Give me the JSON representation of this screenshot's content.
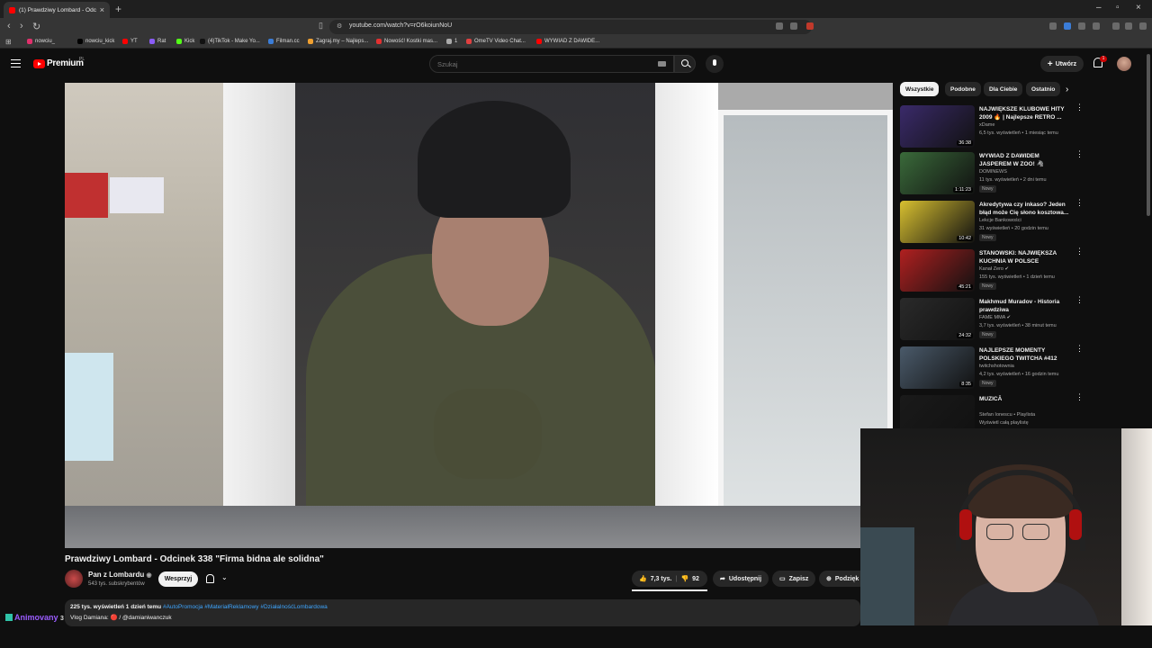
{
  "browser": {
    "tab_title": "(1) Prawdziwy Lombard - Odc...",
    "url": "youtube.com/watch?v=rO6koiunNoU",
    "bookmarks": [
      {
        "label": "nowciu_",
        "color": "#e1306c"
      },
      {
        "label": "nowciu_kick",
        "color": "#000000"
      },
      {
        "label": "YT",
        "color": "#ff0000"
      },
      {
        "label": "Rat",
        "color": "#8a5cf6"
      },
      {
        "label": "Kick",
        "color": "#53fc18"
      },
      {
        "label": "(4)TikTok - Make Yo...",
        "color": "#111111"
      },
      {
        "label": "Filman.cc",
        "color": "#3b7dd8"
      },
      {
        "label": "Zagraj.my – Najleps...",
        "color": "#f0a030"
      },
      {
        "label": "Nowość! Kostki mas...",
        "color": "#e23030"
      },
      {
        "label": "1",
        "color": "#aaaaaa"
      },
      {
        "label": "OmeTV Video Chat...",
        "color": "#e04040"
      },
      {
        "label": "WYWIAD Z DAWIDE...",
        "color": "#ff0000"
      }
    ]
  },
  "header": {
    "logo_text": "Premium",
    "country": "PL",
    "search_placeholder": "Szukaj",
    "create_label": "Utwórz",
    "notif_count": "1"
  },
  "video": {
    "title": "Prawdziwy Lombard - Odcinek 338 \"Firma bidna ale solidna\"",
    "channel": "Pan z Lombardu",
    "subscribers": "543 tys. subskrybentów",
    "support_label": "Wesprzyj",
    "likes": "7,3 tys.",
    "dislikes": "92",
    "share_label": "Udostępnij",
    "save_label": "Zapisz",
    "thanks_label": "Podzięk",
    "views_date": "225 tys. wyświetleń  1 dzień temu",
    "hashtags": "#AutoPromocja #MateriałReklamowy #DziałalnośćLombardowa",
    "desc_line2": "Vlog Damiana:  🔴 / @damianiwanczuk"
  },
  "overlay": {
    "streamer_name": "Animovany",
    "overlay_prefix": "3"
  },
  "chips": [
    "Wszystkie",
    "Podobne",
    "Dla Ciebie",
    "Ostatnio"
  ],
  "recommended": [
    {
      "title": "NAJWIĘKSZE KLUBOWE HITY 2009 🔥 | Najlepsze RETRO ...",
      "channel": "xDame",
      "meta": "6,5 tys. wyświetleń • 1 miesiąc temu",
      "duration": "36:38",
      "badge": "",
      "thumb_color": "#3a2a6a"
    },
    {
      "title": "WYWIAD Z DAWIDEM JASPEREM W ZOO! 🦓",
      "channel": "DOMINEWS",
      "meta": "11 tys. wyświetleń • 2 dni temu",
      "duration": "1:11:23",
      "badge": "Nowy",
      "thumb_color": "#3a6a3a"
    },
    {
      "title": "Akredytywa czy inkaso? Jeden błąd może Cię słono kosztowa...",
      "channel": "Lekcje Bankowości",
      "meta": "31 wyświetleń • 20 godzin temu",
      "duration": "10:42",
      "badge": "Nowy",
      "thumb_color": "#d8c030"
    },
    {
      "title": "STANOWSKI: NAJWIĘKSZA KUCHNIA W POLSCE",
      "channel": "Kanał Zero ✔",
      "meta": "155 tys. wyświetleń • 1 dzień temu",
      "duration": "45:21",
      "badge": "Nowy",
      "thumb_color": "#b02020"
    },
    {
      "title": "Makhmud Muradov - Historia prawdziwa",
      "channel": "FAME MMA ✔",
      "meta": "3,7 tys. wyświetleń • 38 minut temu",
      "duration": "24:32",
      "badge": "Nowy",
      "thumb_color": "#2a2a2a"
    },
    {
      "title": "NAJLEPSZE MOMENTY POLSKIEGO TWITCHA #412",
      "channel": "twitchshotownia",
      "meta": "4,2 tys. wyświetleń • 16 godzin temu",
      "duration": "8:35",
      "badge": "Nowy",
      "thumb_color": "#4a5a6a"
    },
    {
      "title": "MUZICĂ",
      "channel": "Stefan Ionescu • Playlista",
      "meta": "Wyświetl całą playlistę",
      "duration": "",
      "badge": "",
      "thumb_color": "#1a1a1a"
    }
  ]
}
